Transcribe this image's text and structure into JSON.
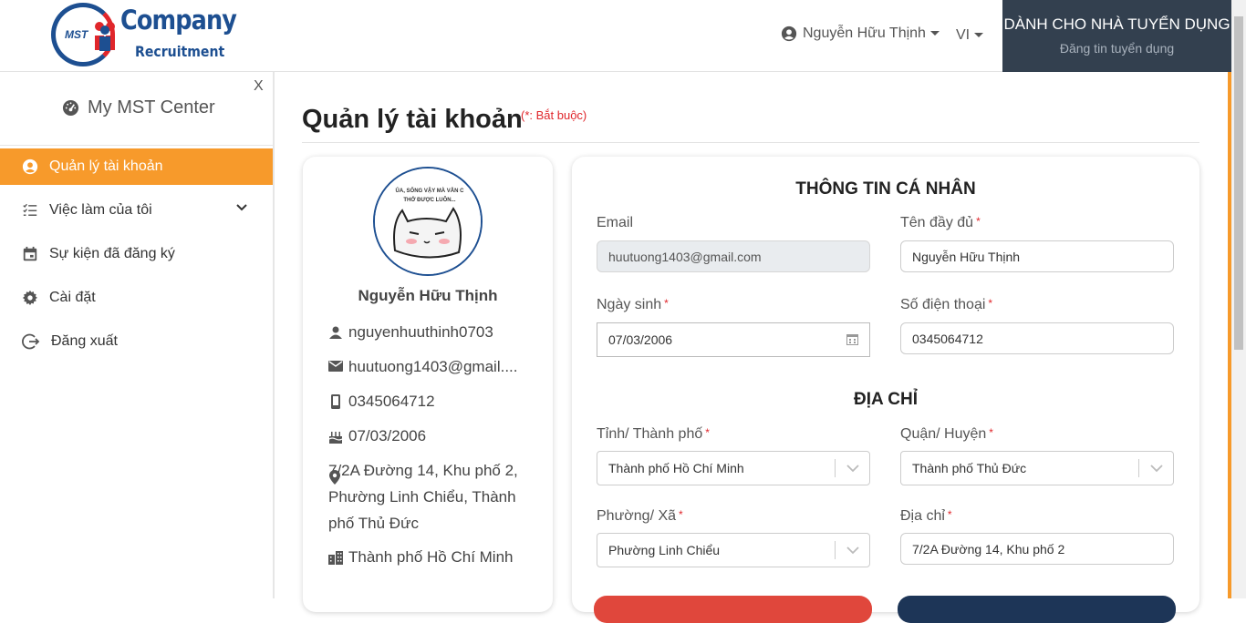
{
  "header": {
    "logo_mark": "MST",
    "logo_company": "Company",
    "logo_recruitment": "Recruitment",
    "user_name": "Nguyễn Hữu Thịnh",
    "language": "VI",
    "employer_title": "DÀNH CHO NHÀ TUYỂN DỤNG",
    "employer_subtitle": "Đăng tin tuyển dụng"
  },
  "sidebar": {
    "close_label": "X",
    "title": "My MST Center",
    "items": [
      {
        "label": "Quản lý tài khoản",
        "icon": "user-circle-icon",
        "active": true
      },
      {
        "label": "Việc làm của tôi",
        "icon": "list-icon",
        "active": false
      },
      {
        "label": "Sự kiện đã đăng ký",
        "icon": "calendar-icon",
        "active": false
      },
      {
        "label": "Cài đặt",
        "icon": "gear-icon",
        "active": false
      },
      {
        "label": "Đăng xuất",
        "icon": "logout-icon",
        "active": false
      }
    ]
  },
  "page": {
    "title": "Quản lý tài khoản",
    "required_note": "(*: Bắt buộc)"
  },
  "profile": {
    "avatar_caption": "ỦA, SỐNG VẬY MÀ VẪN C... THỞ ĐƯỢC LUÔN...",
    "name": "Nguyễn Hữu Thịnh",
    "username": "nguyenhuuthinh0703",
    "email": "huutuong1403@gmail....",
    "phone": "0345064712",
    "birthday": "07/03/2006",
    "address": "7/2A Đường 14, Khu phố 2, Phường Linh Chiểu, Thành phố Thủ Đức",
    "city": "Thành phố Hồ Chí Minh"
  },
  "form": {
    "personal_title": "THÔNG TIN CÁ NHÂN",
    "email_label": "Email",
    "email_value": "huutuong1403@gmail.com",
    "fullname_label": "Tên đầy đủ",
    "fullname_value": "Nguyễn Hữu Thịnh",
    "dob_label": "Ngày sinh",
    "dob_value": "07/03/2006",
    "phone_label": "Số điện thoại",
    "phone_value": "0345064712",
    "address_title": "ĐỊA CHỈ",
    "province_label": "Tỉnh/ Thành phố",
    "province_value": "Thành phố Hồ Chí Minh",
    "district_label": "Quận/ Huyện",
    "district_value": "Thành phố Thủ Đức",
    "ward_label": "Phường/ Xã",
    "ward_value": "Phường Linh Chiểu",
    "street_label": "Địa chỉ",
    "street_value": "7/2A Đường 14, Khu phố 2",
    "required_mark": "*"
  },
  "colors": {
    "accent": "#f79a2b",
    "brand_blue": "#1d4f91",
    "required_red": "#e0262b",
    "employer_bg": "#33404f"
  }
}
